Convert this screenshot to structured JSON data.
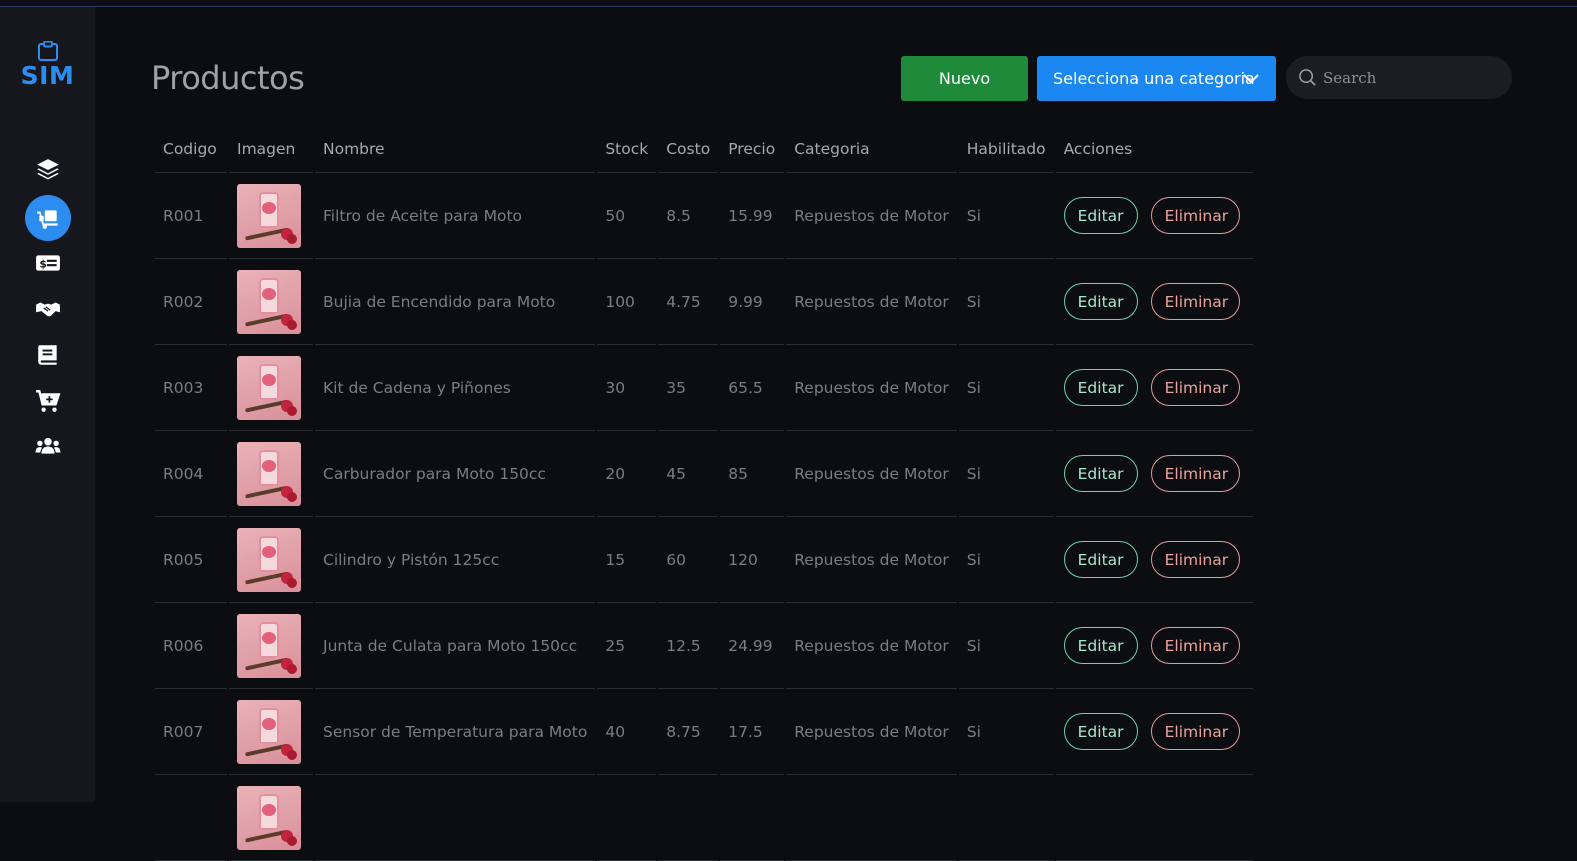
{
  "app": {
    "logo_text": "SIM",
    "logo_icon": "clipboard-icon"
  },
  "sidebar": {
    "items": [
      {
        "icon": "layers-icon"
      },
      {
        "icon": "truck-loading-icon",
        "active": true
      },
      {
        "icon": "money-bill-icon"
      },
      {
        "icon": "handshake-icon"
      },
      {
        "icon": "book-icon"
      },
      {
        "icon": "cart-plus-icon"
      },
      {
        "icon": "users-icon"
      }
    ]
  },
  "header": {
    "title": "Productos",
    "new_button": "Nuevo",
    "category_select": "Selecciona una categoria",
    "search_placeholder": "Search"
  },
  "table": {
    "columns": [
      "Codigo",
      "Imagen",
      "Nombre",
      "Stock",
      "Costo",
      "Precio",
      "Categoria",
      "Habilitado",
      "Acciones"
    ],
    "edit_label": "Editar",
    "delete_label": "Eliminar",
    "rows": [
      {
        "codigo": "R001",
        "nombre": "Filtro de Aceite para Moto",
        "stock": "50",
        "costo": "8.5",
        "precio": "15.99",
        "categoria": "Repuestos de Motor",
        "habilitado": "Si"
      },
      {
        "codigo": "R002",
        "nombre": "Bujia de Encendido para Moto",
        "stock": "100",
        "costo": "4.75",
        "precio": "9.99",
        "categoria": "Repuestos de Motor",
        "habilitado": "Si"
      },
      {
        "codigo": "R003",
        "nombre": "Kit de Cadena y Piñones",
        "stock": "30",
        "costo": "35",
        "precio": "65.5",
        "categoria": "Repuestos de Motor",
        "habilitado": "Si"
      },
      {
        "codigo": "R004",
        "nombre": "Carburador para Moto 150cc",
        "stock": "20",
        "costo": "45",
        "precio": "85",
        "categoria": "Repuestos de Motor",
        "habilitado": "Si"
      },
      {
        "codigo": "R005",
        "nombre": "Cilindro y Pistón 125cc",
        "stock": "15",
        "costo": "60",
        "precio": "120",
        "categoria": "Repuestos de Motor",
        "habilitado": "Si"
      },
      {
        "codigo": "R006",
        "nombre": "Junta de Culata para Moto 150cc",
        "stock": "25",
        "costo": "12.5",
        "precio": "24.99",
        "categoria": "Repuestos de Motor",
        "habilitado": "Si"
      },
      {
        "codigo": "R007",
        "nombre": "Sensor de Temperatura para Moto",
        "stock": "40",
        "costo": "8.75",
        "precio": "17.5",
        "categoria": "Repuestos de Motor",
        "habilitado": "Si"
      },
      {
        "codigo": "",
        "nombre": "",
        "stock": "",
        "costo": "",
        "precio": "",
        "categoria": "",
        "habilitado": ""
      }
    ]
  },
  "colors": {
    "accent": "#2d8cf0",
    "new_button": "#1f8b3a",
    "select": "#1b88f2",
    "background": "#0c0d10",
    "sidebar": "#15171d"
  }
}
